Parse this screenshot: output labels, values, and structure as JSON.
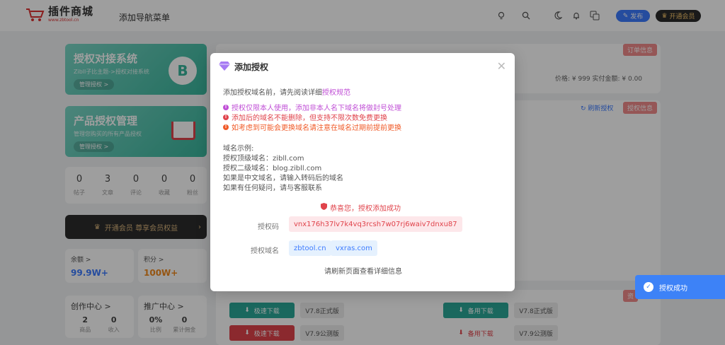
{
  "header": {
    "logo_text": "插件商城",
    "logo_sub": "www.zbtool.cn",
    "nav_item": "添加导航菜单",
    "publish_label": "发布",
    "vip_label": "开通会员"
  },
  "sidebar": {
    "promo1": {
      "title": "授权对接系统",
      "subtitle": "Zibll子比主题->授权对接系统",
      "button": "管理授权 >"
    },
    "promo2": {
      "title": "产品授权管理",
      "subtitle": "管理您购买的所有产品授权",
      "button": "管理授权 >"
    },
    "stats": [
      {
        "value": "0",
        "label": "帖子"
      },
      {
        "value": "3",
        "label": "文章"
      },
      {
        "value": "0",
        "label": "评论"
      },
      {
        "value": "0",
        "label": "收藏"
      },
      {
        "value": "0",
        "label": "粉丝"
      }
    ],
    "vip_banner": "开通会员 尊享会员权益",
    "balance": {
      "label": "余额 >",
      "value": "99.9W+"
    },
    "points": {
      "label": "积分 >",
      "value": "100W+"
    },
    "creator": {
      "label": "创作中心 >",
      "items": [
        {
          "value": "2",
          "label": "商品"
        },
        {
          "value": "0",
          "label": "收入"
        }
      ]
    },
    "promote": {
      "label": "推广中心 >",
      "items": [
        {
          "value": "0%",
          "label": "比例"
        },
        {
          "value": "0",
          "label": "累计佣金"
        }
      ]
    }
  },
  "main": {
    "order_tag": "订单信息",
    "auth_tag": "授权信息",
    "refresh_label": "刷新授权",
    "price_text": "价格: ¥ 999  实付金额: ¥ 0.00",
    "download_fast": "极速下载",
    "download_backup": "备用下载",
    "ver_stable": "V7.8正式版",
    "ver_beta": "V7.9公测版"
  },
  "modal": {
    "title": "添加授权",
    "intro": "添加授权域名前，请先阅读详细",
    "intro_link": "授权规范",
    "warnings": [
      "授权仅限本人使用，添加非本人名下域名将做封号处理",
      "添加后的域名不能删除，但支持不限次数免费更换",
      "如考虑到可能会更换域名请注意在域名过期前提前更换"
    ],
    "example_title": "域名示例:",
    "examples": [
      "授权顶级域名：zibll.com",
      "授权二级域名：blog.zibll.com",
      "如果是中文域名，请输入转码后的域名",
      "如果有任何疑问，请与客服联系"
    ],
    "success_text": "恭喜您，授权添加成功",
    "code_label": "授权码",
    "code_value": "vnx176h37lv7k4vq3rcsh7w07rj6waiv7dnxu87",
    "domain_label": "授权域名",
    "domains": [
      "zbtool.cn",
      "vxras.com"
    ],
    "footer": "请刷新页面查看详细信息"
  },
  "toast": {
    "text": "授权成功"
  },
  "colors": {
    "accent": "#3d7bff",
    "danger": "#e0434b",
    "warn_pink": "#c04fd6",
    "warn_orange": "#f05a28"
  }
}
